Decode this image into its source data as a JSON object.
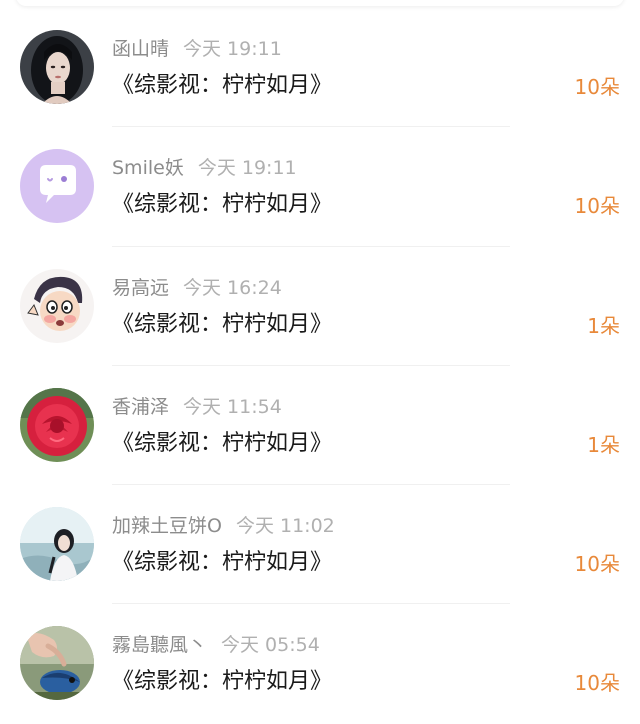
{
  "colors": {
    "name_text": "#8c8c8c",
    "time_text": "#b0b0b0",
    "title_text": "#1a1a1a",
    "count_accent": "#e8893a",
    "divider": "#f0f0f0"
  },
  "rows": [
    {
      "name": "函山晴",
      "time": "今天 19:11",
      "title": "《综影视：柠柠如月》",
      "count": "10朵",
      "avatar_icon": "dark-hair-portrait-avatar"
    },
    {
      "name": "Smile妖",
      "time": "今天 19:11",
      "title": "《综影视：柠柠如月》",
      "count": "10朵",
      "avatar_icon": "purple-chat-bubble-avatar"
    },
    {
      "name": "易高远",
      "time": "今天 16:24",
      "title": "《综影视：柠柠如月》",
      "count": "1朵",
      "avatar_icon": "cartoon-face-avatar"
    },
    {
      "name": "香浦泽",
      "time": "今天 11:54",
      "title": "《综影视：柠柠如月》",
      "count": "1朵",
      "avatar_icon": "red-rose-avatar"
    },
    {
      "name": "加辣土豆饼O",
      "time": "今天 11:02",
      "title": "《综影视：柠柠如月》",
      "count": "10朵",
      "avatar_icon": "girl-photo-avatar"
    },
    {
      "name": "霧島聽風丶",
      "time": "今天 05:54",
      "title": "《综影视：柠柠如月》",
      "count": "10朵",
      "avatar_icon": "hand-bird-photo-avatar"
    }
  ]
}
